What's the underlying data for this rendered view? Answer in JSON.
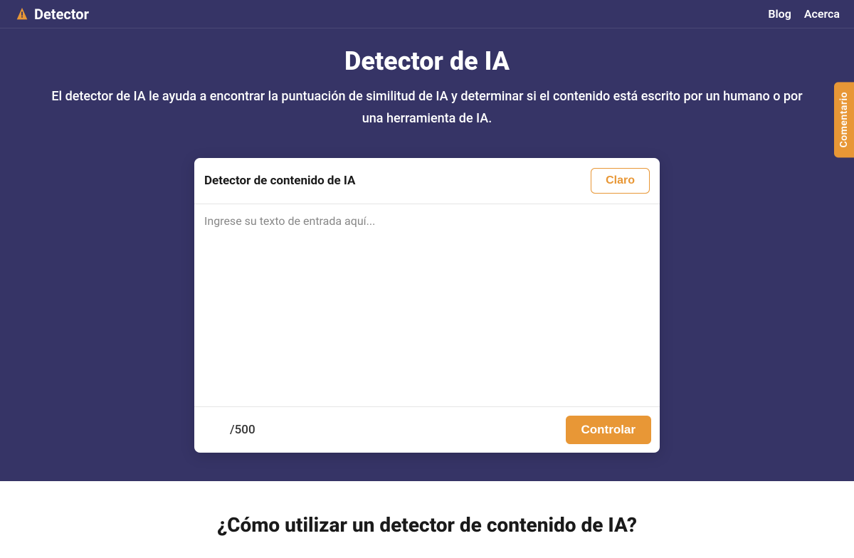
{
  "header": {
    "logo_text": "Detector",
    "nav": {
      "blog": "Blog",
      "about": "Acerca"
    }
  },
  "hero": {
    "title": "Detector de IA",
    "subtitle": "El detector de IA le ayuda a encontrar la puntuación de similitud de IA y determinar si el contenido está escrito por un humano o por una herramienta de IA."
  },
  "card": {
    "title": "Detector de contenido de IA",
    "clear_label": "Claro",
    "placeholder": "Ingrese su texto de entrada aquí...",
    "counter": "/500",
    "check_label": "Controlar"
  },
  "section": {
    "how_to_title": "¿Cómo utilizar un detector de contenido de IA?"
  },
  "feedback": {
    "label": "Comentario"
  },
  "colors": {
    "primary_bg": "#363466",
    "accent": "#e89736"
  }
}
